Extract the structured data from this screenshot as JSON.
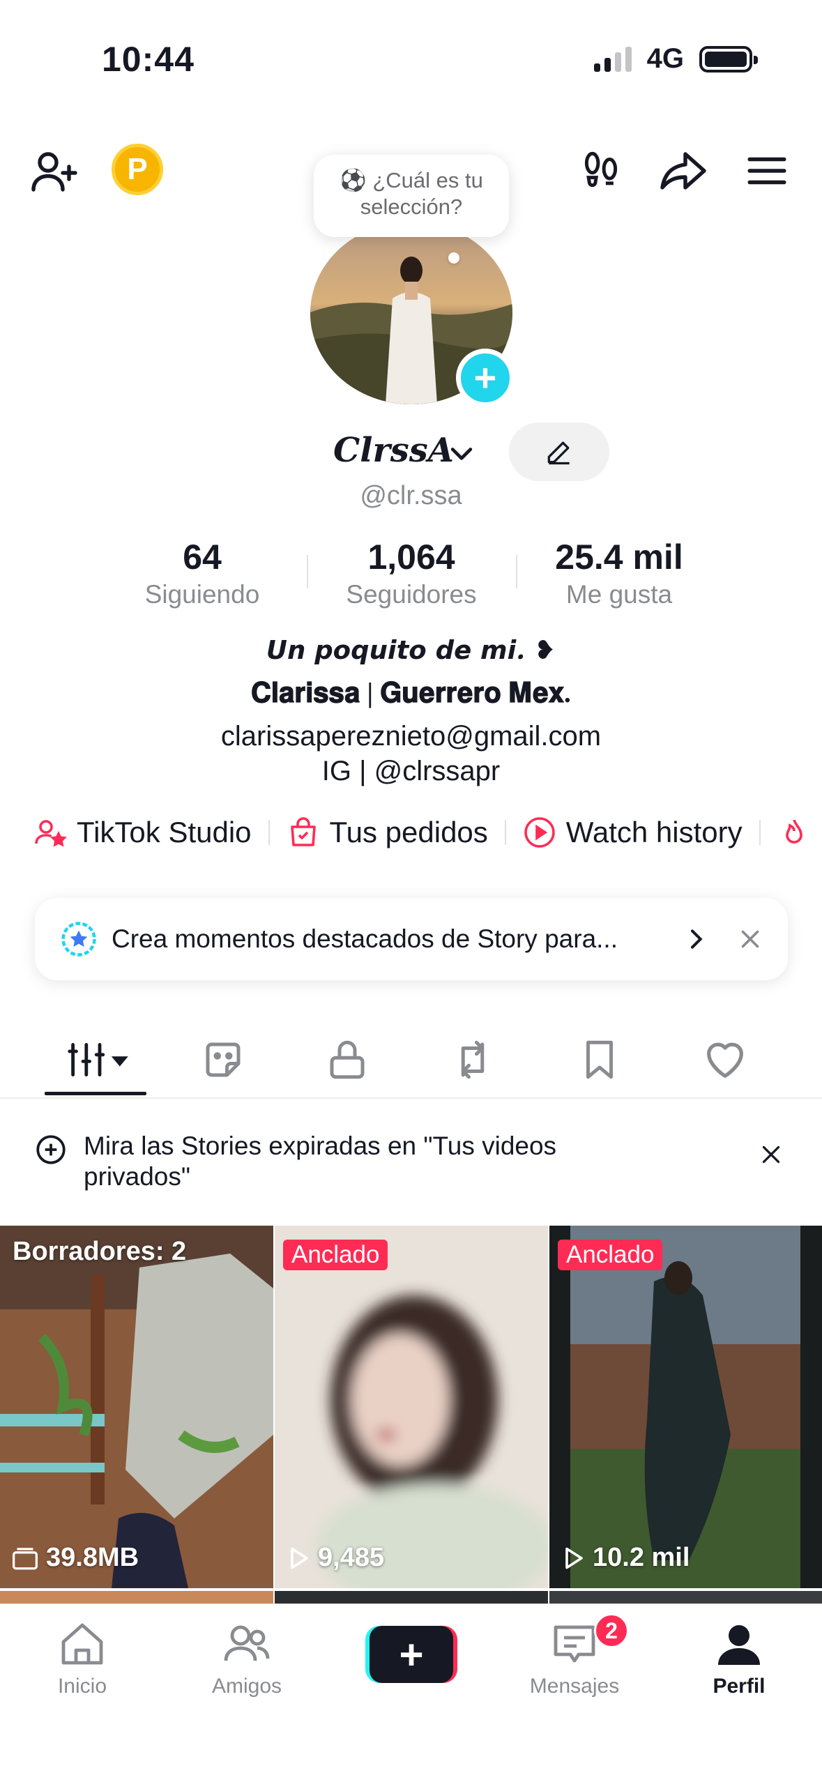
{
  "status_bar": {
    "time": "10:44",
    "network": "4G"
  },
  "header": {
    "coin_letter": "P"
  },
  "bubble": {
    "line1": "⚽ ¿Cuál es tu",
    "line2": "selección?"
  },
  "profile": {
    "display_name": "ClrssA",
    "username": "@clr.ssa",
    "stats": [
      {
        "value": "64",
        "label": "Siguiendo"
      },
      {
        "value": "1,064",
        "label": "Seguidores"
      },
      {
        "value": "25.4 mil",
        "label": "Me gusta"
      }
    ],
    "bio": [
      "𝙐𝙣 𝙥𝙤𝙦𝙪𝙞𝙩𝙤 𝙙𝙚 𝙢𝙞. ❥",
      "𝐂𝐥𝐚𝐫𝐢𝐬𝐬𝐚 | 𝐆𝐮𝐞𝐫𝐫𝐞𝐫𝐨 𝐌𝐞𝐱.",
      "clarissapereznieto@gmail.com",
      "IG | @clrssapr"
    ]
  },
  "quick_links": [
    {
      "label": "TikTok Studio",
      "icon": "person-star-icon"
    },
    {
      "label": "Tus pedidos",
      "icon": "shopping-bag-icon"
    },
    {
      "label": "Watch history",
      "icon": "play-circle-icon"
    }
  ],
  "story_banner": {
    "text": "Crea momentos destacados de Story para..."
  },
  "tabs": [
    "videos-grid",
    "stickers",
    "private",
    "reposts",
    "favorites",
    "liked"
  ],
  "notice": {
    "text": "Mira las Stories expiradas en \"Tus videos privados\""
  },
  "videos": [
    {
      "label": "Borradores: 2",
      "stat": "39.8MB",
      "stat_icon": "storage-icon"
    },
    {
      "pinned": "Anclado",
      "stat": "9,485",
      "stat_icon": "play-icon"
    },
    {
      "pinned": "Anclado",
      "stat": "10.2 mil",
      "stat_icon": "play-icon"
    }
  ],
  "nav": {
    "home": "Inicio",
    "friends": "Amigos",
    "messages": "Mensajes",
    "messages_badge": "2",
    "profile": "Perfil"
  },
  "colors": {
    "accent": "#fe2c55",
    "cyan": "#20d5ec",
    "text": "#161823",
    "muted": "#8a8b91"
  }
}
